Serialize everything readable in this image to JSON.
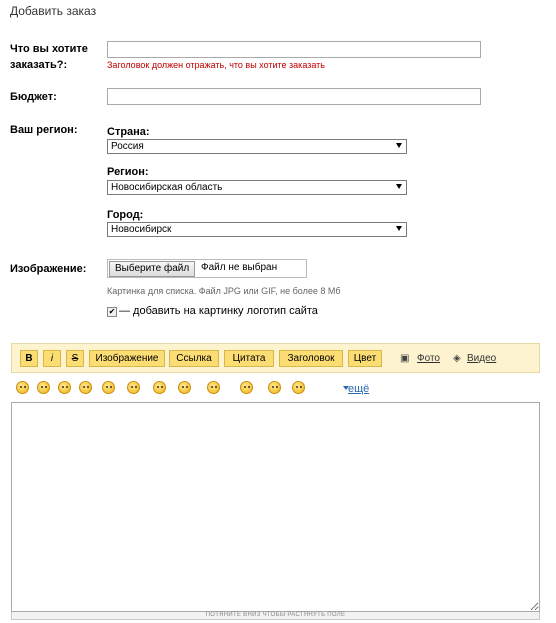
{
  "page_title": "Добавить заказ",
  "form": {
    "what_label": "Что вы хотите заказать?:",
    "what_value": "",
    "what_hint": "Заголовок должен отражать, что вы хотите заказать",
    "budget_label": "Бюджет:",
    "budget_value": "",
    "region_label": "Ваш регион:",
    "country_label": "Страна:",
    "country_value": "Россия",
    "region_sub_label": "Регион:",
    "region_value": "Новосибирская область",
    "city_label": "Город:",
    "city_value": "Новосибирск",
    "image_label": "Изображение:",
    "file_button_label": "Выберите файл",
    "file_status": "Файл не выбран",
    "image_hint": "Картинка для списка. Файл JPG или GIF, не более 8 Мб",
    "logo_checkbox_checked": true,
    "logo_checkbox_label": "— добавить на картинку логотип сайта"
  },
  "toolbar": {
    "bold": "B",
    "italic": "i",
    "strike": "S",
    "image": "Изображение",
    "link": "Ссылка",
    "quote": "Цитата",
    "heading": "Заголовок",
    "color": "Цвет",
    "photo": "Фото",
    "video": "Видео"
  },
  "smileys": [
    "smile-icon",
    "angry-icon",
    "wink-icon",
    "grin-icon",
    "thumbs-icon",
    "think-icon",
    "blush-icon",
    "girl-icon",
    "kiss-icon",
    "crazy-icon",
    "shock-icon",
    "shout-icon"
  ],
  "more_smileys": "ещё",
  "editor": {
    "value": "",
    "resize_hint": "ПОТЯНИТЕ ВНИЗ ЧТОБЫ РАСТЯНУТЬ ПОЛЕ"
  },
  "colors": {
    "error": "#c00000",
    "toolbar_bg": "#fdf3cf",
    "toolbar_button": "#fcdd74",
    "link": "#2a6ab0"
  }
}
